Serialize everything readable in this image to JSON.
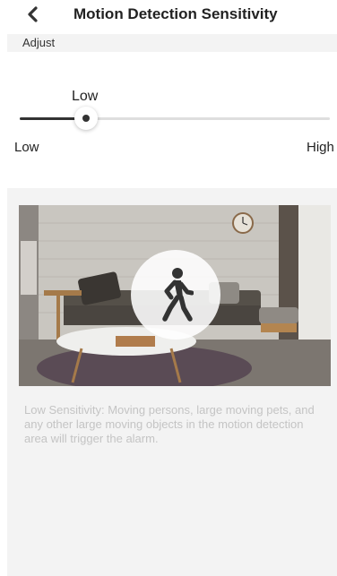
{
  "header": {
    "title": "Motion Detection Sensitivity",
    "back_icon": "chevron-left-icon"
  },
  "adjust": {
    "label": "Adjust"
  },
  "sensitivity": {
    "current_label": "Low",
    "min_label": "Low",
    "max_label": "High",
    "level_fraction": 0.215
  },
  "preview": {
    "scene": "living-room-photo",
    "badge_icon": "walking-person-icon",
    "description": "Low Sensitivity: Moving persons, large moving pets, and any other large moving objects in the motion detection area will trigger the alarm."
  },
  "colors": {
    "track": "#dedede",
    "fill": "#333333",
    "panel": "#f3f3f3",
    "description_text": "#c4c4c4"
  }
}
